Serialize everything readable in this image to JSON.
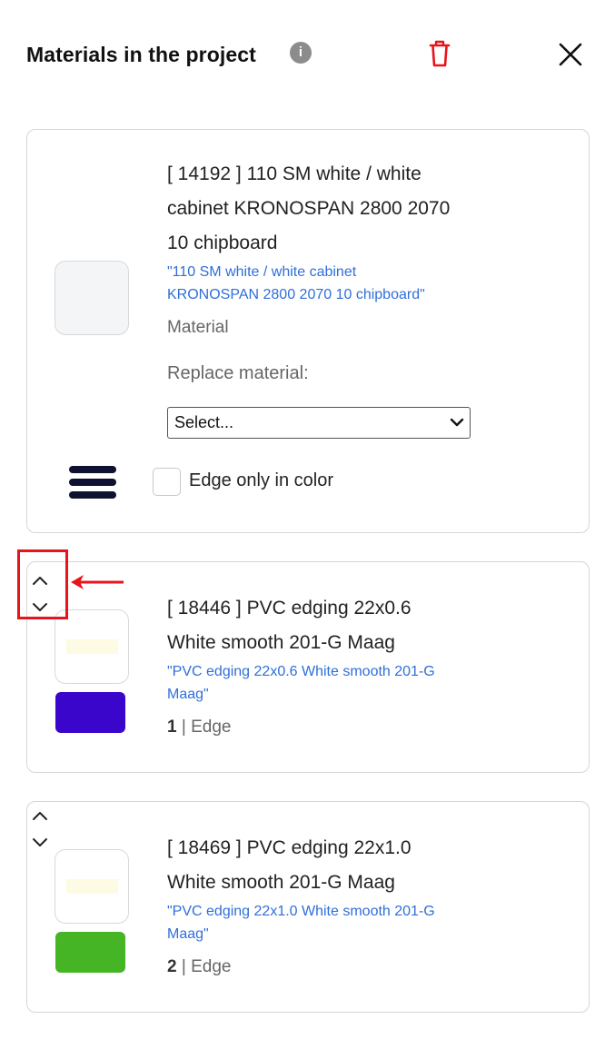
{
  "header": {
    "title": "Materials in the project",
    "info_glyph": "i",
    "icons": [
      "info-icon",
      "trash-icon",
      "close-icon"
    ],
    "trash_color": "#e8141b"
  },
  "materials": [
    {
      "title_lines": [
        "[ 14192 ] 110 SM white / white",
        "cabinet KRONOSPAN 2800 2070",
        "10 chipboard"
      ],
      "subtitle_lines": [
        "\"110 SM white / white cabinet",
        "KRONOSPAN 2800 2070 10 chipboard\""
      ],
      "type_label": "Material",
      "replace_label": "Replace material:",
      "select_value": "Select...",
      "checkbox_label": "Edge only in color",
      "checkbox_checked": false
    },
    {
      "title_lines": [
        "[ 18446 ] PVC edging 22x0.6",
        "White smooth 201-G Maag"
      ],
      "subtitle_lines": [
        "\"PVC edging 22x0.6 White smooth 201-G",
        "Maag\""
      ],
      "index": "1",
      "separator": " | ",
      "type_label": "Edge",
      "color": "#3a06cc"
    },
    {
      "title_lines": [
        "[ 18469 ] PVC edging 22x1.0",
        "White smooth 201-G Maag"
      ],
      "subtitle_lines": [
        "\"PVC edging 22x1.0 White smooth 201-G",
        "Maag\""
      ],
      "index": "2",
      "separator": " | ",
      "type_label": "Edge",
      "color": "#46b525"
    }
  ],
  "annotation": {
    "highlight_color": "#e8141b"
  }
}
